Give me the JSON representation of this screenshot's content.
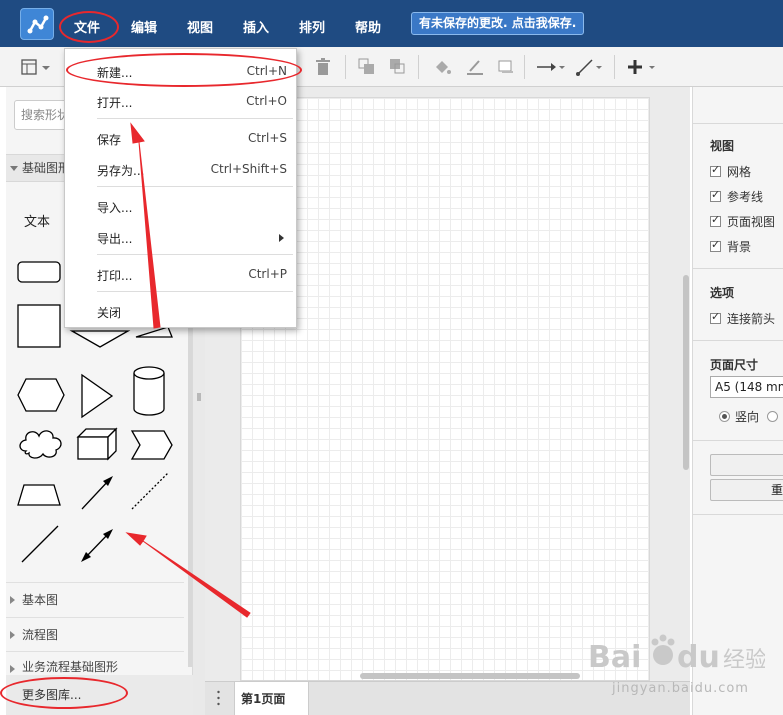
{
  "menubar": {
    "items": [
      "文件",
      "编辑",
      "视图",
      "插入",
      "排列",
      "帮助"
    ],
    "unsaved_notice": "有未保存的更改. 点击我保存."
  },
  "sidebar": {
    "search_placeholder": "搜索形状",
    "basic_shapes_header": "基础图形",
    "text_shape_label": "文本",
    "libraries": [
      "基本图",
      "流程图",
      "业务流程基础图形"
    ],
    "more_libraries": "更多图库..."
  },
  "file_menu": {
    "items": [
      {
        "label": "新建...",
        "shortcut": "Ctrl+N"
      },
      {
        "label": "打开...",
        "shortcut": "Ctrl+O"
      },
      {
        "label": "保存",
        "shortcut": "Ctrl+S"
      },
      {
        "label": "另存为...",
        "shortcut": "Ctrl+Shift+S"
      },
      {
        "label": "导入...",
        "shortcut": ""
      },
      {
        "label": "导出...",
        "shortcut": ""
      },
      {
        "label": "打印...",
        "shortcut": "Ctrl+P"
      },
      {
        "label": "关闭",
        "shortcut": ""
      }
    ]
  },
  "right_panel": {
    "view_title": "视图",
    "view_options": [
      {
        "label": "网格",
        "checked": true
      },
      {
        "label": "参考线",
        "checked": true
      },
      {
        "label": "页面视图",
        "checked": true
      },
      {
        "label": "背景",
        "checked": true
      }
    ],
    "options_title": "选项",
    "options": [
      {
        "label": "连接箭头",
        "checked": true
      }
    ],
    "page_size_title": "页面尺寸",
    "page_size_value": "A5 (148 mm",
    "orientation_portrait": "竖向",
    "button_2_label": "重"
  },
  "page_tabs": [
    "第1页面"
  ],
  "watermark": {
    "text": "jingyan.baidu.com"
  },
  "colors": {
    "menubar": "#1f4b82",
    "annotation": "#e8282d",
    "accent": "#3a78c6"
  }
}
